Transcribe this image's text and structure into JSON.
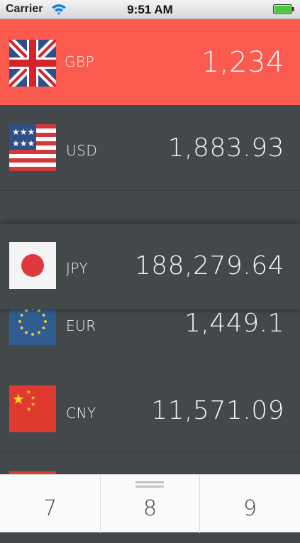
{
  "status_bar": {
    "carrier": "Carrier",
    "time": "9:51 AM"
  },
  "currencies": [
    {
      "code": "GBP",
      "value": "1,234",
      "flag": "uk-flag",
      "active": true
    },
    {
      "code": "USD",
      "value": "1,883.93",
      "flag": "us-flag"
    },
    {
      "code": "JPY",
      "value": "188,279.64",
      "flag": "japan-flag",
      "dragging": true
    },
    {
      "code": "EUR",
      "value": "1,449.1",
      "flag": "eu-flag"
    },
    {
      "code": "CNY",
      "value": "11,571.09",
      "flag": "china-flag"
    }
  ],
  "keypad": {
    "keys": [
      "7",
      "8",
      "9"
    ]
  },
  "colors": {
    "active_row": "#fb5a4e",
    "row_bg": "#43484b",
    "keypad_bg": "#fafafa"
  }
}
